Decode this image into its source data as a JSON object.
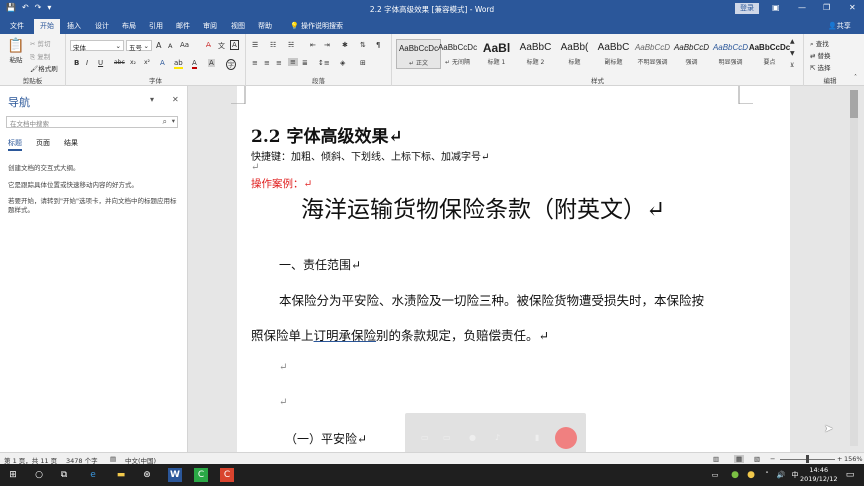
{
  "titlebar": {
    "title": "2.2 字体高级效果 [兼容模式] - Word",
    "login_label": "登录",
    "qat_icons": [
      "save-icon",
      "undo-icon",
      "redo-icon",
      "customize-icon"
    ],
    "win_icons": [
      "ribbon-display-icon",
      "minimize-icon",
      "restore-icon",
      "close-icon"
    ]
  },
  "tabs": [
    "文件",
    "开始",
    "插入",
    "设计",
    "布局",
    "引用",
    "邮件",
    "审阅",
    "视图",
    "帮助"
  ],
  "active_tab": "开始",
  "tellme": "操作说明搜索",
  "share": "共享",
  "ribbon": {
    "clipboard": {
      "label": "剪贴板",
      "paste": "粘贴",
      "cut": "剪切",
      "copy": "复制",
      "format_painter": "格式刷"
    },
    "font": {
      "label": "字体",
      "font_name": "宋体",
      "font_size": "五号",
      "grow": "A",
      "shrink": "A",
      "case": "Aa",
      "bold": "B",
      "italic": "I",
      "underline": "U",
      "strike": "abc",
      "sub": "x₂",
      "sup": "x²",
      "font_color_sample": "A"
    },
    "paragraph": {
      "label": "段落"
    },
    "styles": {
      "label": "样式",
      "items": [
        {
          "sample": "AaBbCcDc",
          "name": "↵ 正文"
        },
        {
          "sample": "AaBbCcDc",
          "name": "↵ 无间隔"
        },
        {
          "sample": "AaBl",
          "name": "标题 1"
        },
        {
          "sample": "AaBbC",
          "name": "标题 2"
        },
        {
          "sample": "AaBb(",
          "name": "标题"
        },
        {
          "sample": "AaBbC",
          "name": "副标题"
        },
        {
          "sample": "AaBbCcD",
          "name": "不明显强调"
        },
        {
          "sample": "AaBbCcD",
          "name": "强调"
        },
        {
          "sample": "AaBbCcD",
          "name": "明显强调"
        },
        {
          "sample": "AaBbCcDc",
          "name": "要点"
        }
      ]
    },
    "editing": {
      "label": "编辑",
      "find": "查找",
      "replace": "替换",
      "select": "选择"
    }
  },
  "nav": {
    "title": "导航",
    "search_placeholder": "在文档中搜索",
    "tabs": [
      "标题",
      "页面",
      "结果"
    ],
    "msg1": "创建文档的交互式大纲。",
    "msg2": "它是跟踪具体位置或快速移动内容的好方式。",
    "msg3": "若要开始，请转到\"开始\"选项卡，并向文档中的标题应用标题样式。"
  },
  "doc": {
    "heading": "2.2  字体高级效果↵",
    "shortcut": "快捷键：加粗、倾斜、下划线、上标下标、加减字号↵",
    "blank1": "↵",
    "case_label": "操作案例：↵",
    "main_title": "海洋运输货物保险条款（附英文）↵",
    "section1": "一、责任范围↵",
    "para1": "本保险分为平安险、水渍险及一切险三种。被保险货物遭受损失时，本保险按",
    "para2_pre": "照保险单上",
    "para2_ul": "订明承保险",
    "para2_post": "别的条款规定，负赔偿责任。↵",
    "blank2": "↵",
    "blank3": "↵",
    "sub1": "（一）平安险↵"
  },
  "status": {
    "page": "第 1 页，共 11 页",
    "words": "3478 个字",
    "lang": "中文(中国)",
    "zoom": "156%"
  },
  "taskbar": {
    "time": "14:46",
    "date": "2019/12/12"
  }
}
